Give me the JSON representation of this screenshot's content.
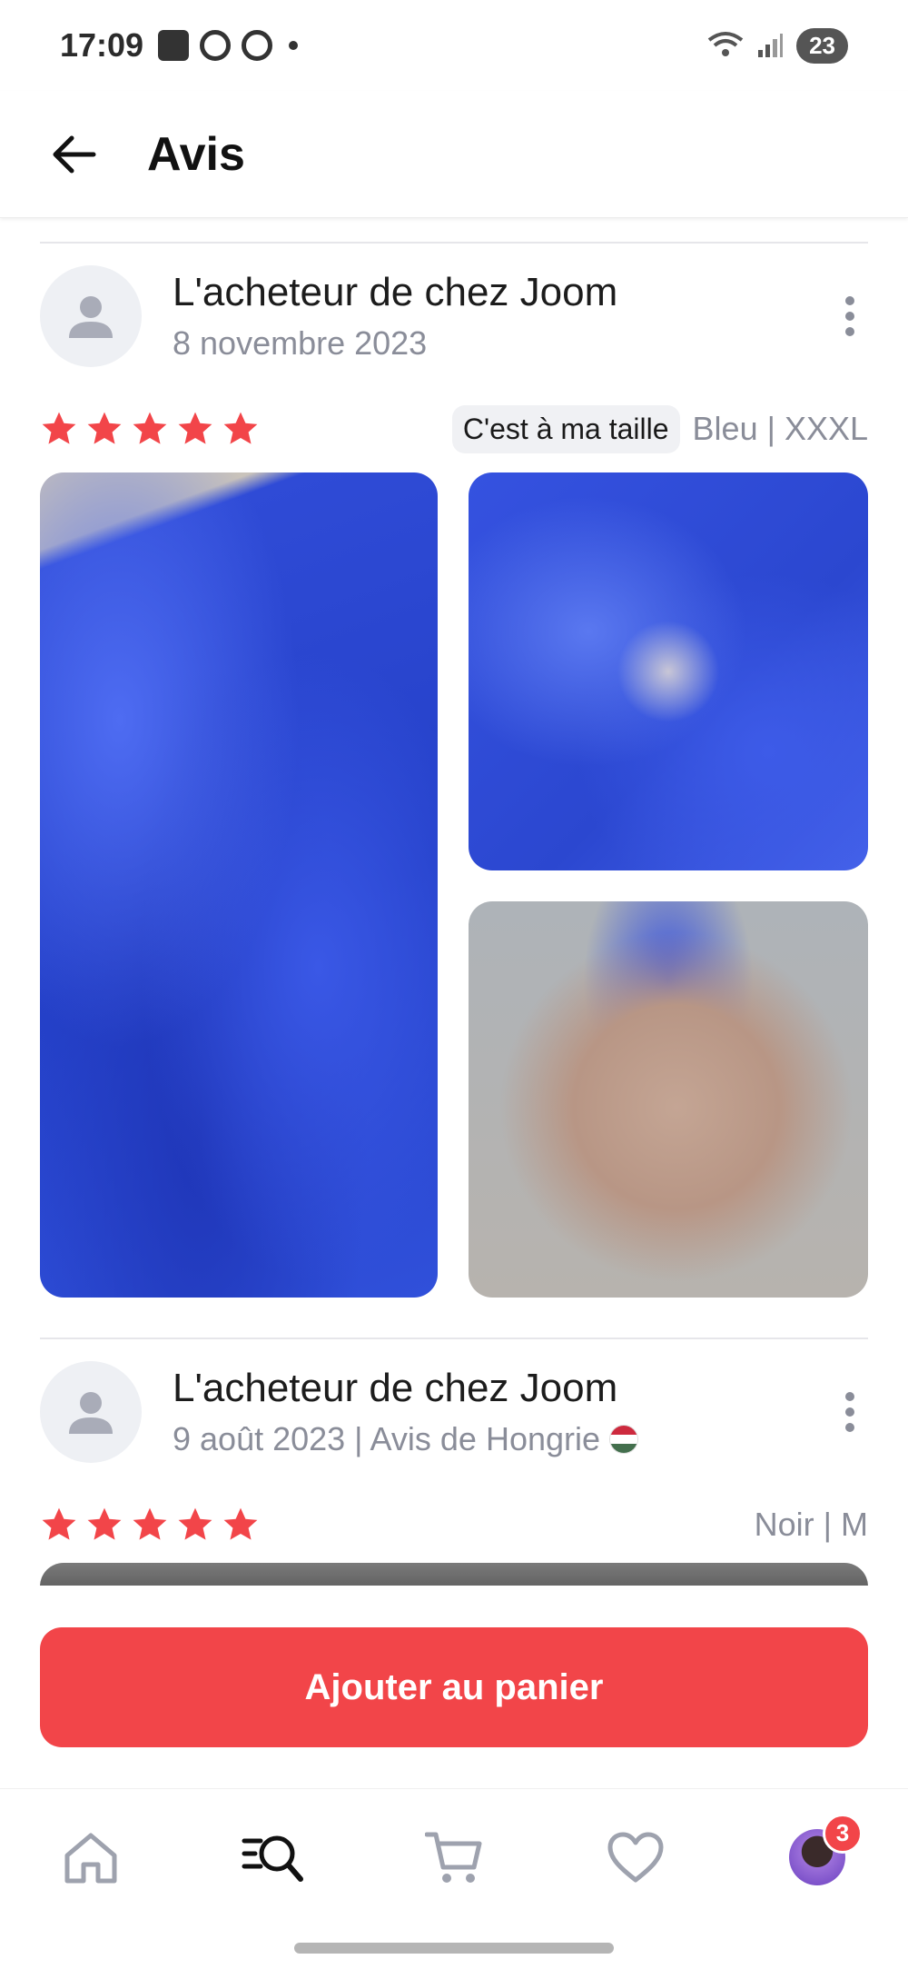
{
  "status_bar": {
    "time": "17:09",
    "battery": "23"
  },
  "header": {
    "title": "Avis"
  },
  "reviews": [
    {
      "reviewer": "L'acheteur de chez Joom",
      "date": "8 novembre 2023",
      "rating": 5,
      "fit_chip": "C'est à ma taille",
      "variant": "Bleu | XXXL"
    },
    {
      "reviewer": "L'acheteur de chez Joom",
      "date": "9 août 2023 | Avis de Hongrie",
      "rating": 5,
      "variant": "Noir | M"
    }
  ],
  "cta": {
    "label": "Ajouter au panier"
  },
  "bottom_nav": {
    "cart_badge": "3"
  },
  "colors": {
    "accent": "#f24549",
    "star": "#f24549",
    "muted": "#8a8d99"
  }
}
